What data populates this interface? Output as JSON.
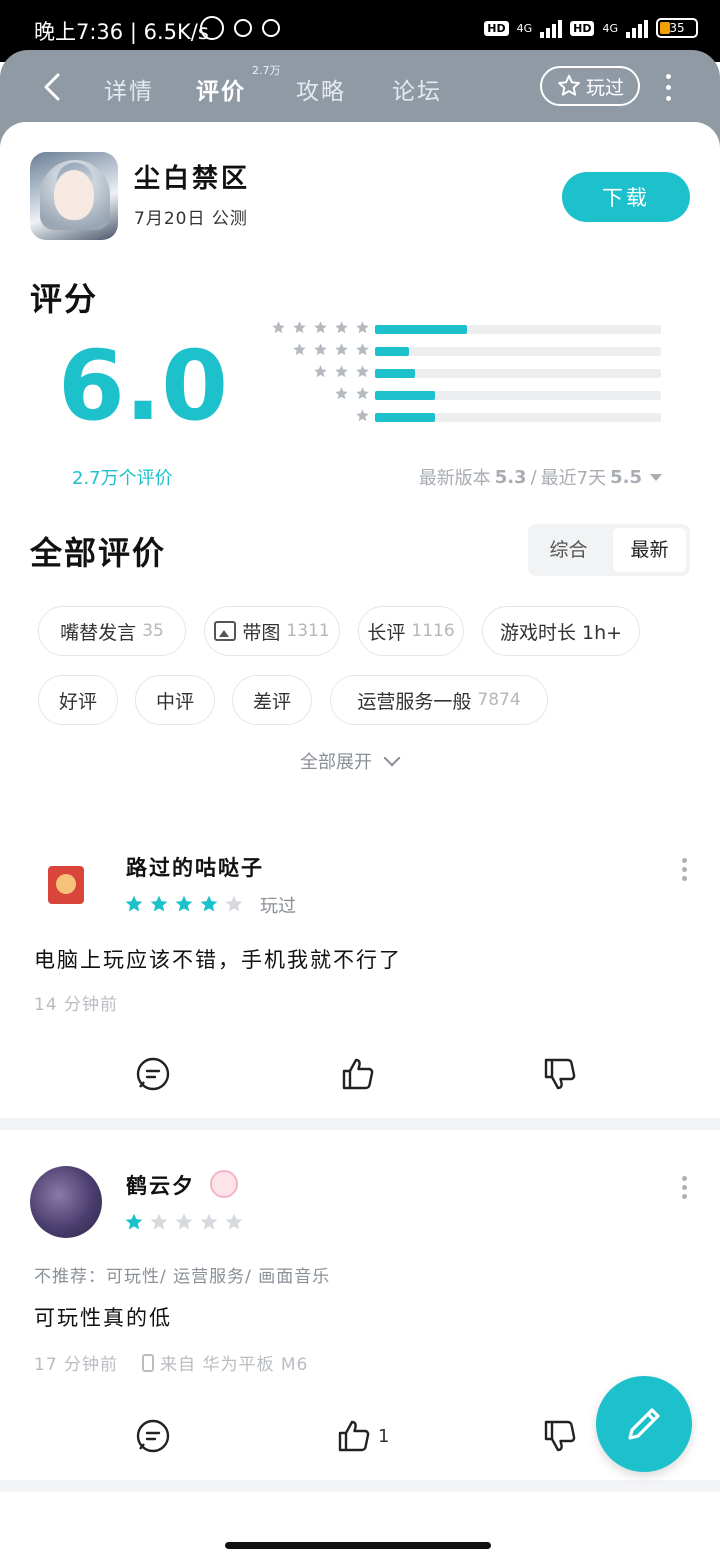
{
  "status": {
    "time": "晚上7:36 | 6.5K/s",
    "hd1": "HD",
    "hd2": "HD",
    "net1": "4G",
    "net2": "4G",
    "battery": "35"
  },
  "nav": {
    "tabs": [
      {
        "label": "详情"
      },
      {
        "label": "评价"
      },
      {
        "label": "攻略"
      },
      {
        "label": "论坛"
      }
    ],
    "review_count_badge": "2.7万",
    "played_label": "玩过"
  },
  "app": {
    "name": "尘白禁区",
    "subtitle": "7月20日 公测",
    "download_label": "下载"
  },
  "rating": {
    "title": "评分",
    "score": "6.0",
    "count_label": "2.7万个评价",
    "distribution": [
      {
        "stars": 5,
        "fraction": 0.32
      },
      {
        "stars": 4,
        "fraction": 0.12
      },
      {
        "stars": 3,
        "fraction": 0.14
      },
      {
        "stars": 2,
        "fraction": 0.21
      },
      {
        "stars": 1,
        "fraction": 0.21
      }
    ],
    "latest_version_label": "最新版本",
    "latest_version_score": "5.3",
    "separator": "/",
    "recent_label": "最近7天",
    "recent_score": "5.5"
  },
  "all_reviews": {
    "title": "全部评价",
    "sort_options": [
      "综合",
      "最新"
    ],
    "selected_sort": "最新",
    "chips": [
      {
        "label": "嘴替发言",
        "count": "35"
      },
      {
        "label": "带图",
        "count": "1311",
        "icon": "image-icon"
      },
      {
        "label": "长评",
        "count": "1116"
      },
      {
        "label": "游戏时长 1h+",
        "count": ""
      },
      {
        "label": "好评",
        "count": ""
      },
      {
        "label": "中评",
        "count": ""
      },
      {
        "label": "差评",
        "count": ""
      },
      {
        "label": "运营服务一般",
        "count": "7874"
      }
    ],
    "expand_label": "全部展开"
  },
  "reviews": [
    {
      "user": "路过的咕哒子",
      "stars": 4,
      "tag": "玩过",
      "content": "电脑上玩应该不错，手机我就不行了",
      "time": "14 分钟前",
      "likes": ""
    },
    {
      "user": "鹤云夕",
      "stars": 1,
      "not_recommend": "不推荐：可玩性/ 运营服务/ 画面音乐",
      "content": "可玩性真的低",
      "time": "17 分钟前",
      "device": "来自 华为平板 M6",
      "likes": "1"
    }
  ],
  "colors": {
    "accent": "#1cc1cc",
    "nav_bg": "#8f9aa5"
  }
}
